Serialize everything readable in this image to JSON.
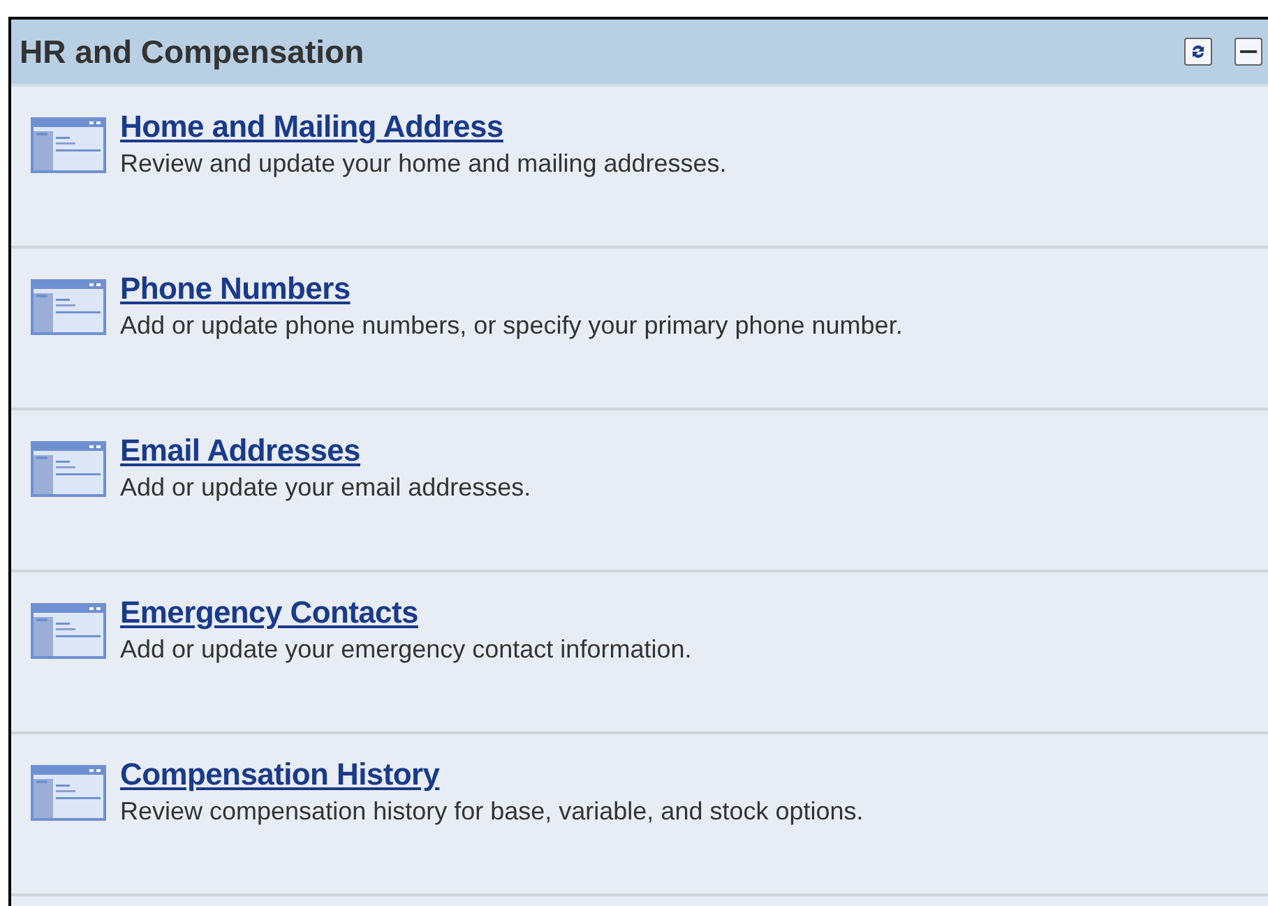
{
  "panel": {
    "title": "HR and Compensation",
    "items": [
      {
        "title": "Home and Mailing Address",
        "description": "Review and update your home and mailing addresses."
      },
      {
        "title": "Phone Numbers",
        "description": "Add or update phone numbers, or specify your primary phone number."
      },
      {
        "title": "Email Addresses",
        "description": "Add or update your email addresses."
      },
      {
        "title": "Emergency Contacts",
        "description": "Add or update your emergency contact information."
      },
      {
        "title": "Compensation History",
        "description": "Review compensation history for base, variable, and stock options."
      }
    ]
  }
}
